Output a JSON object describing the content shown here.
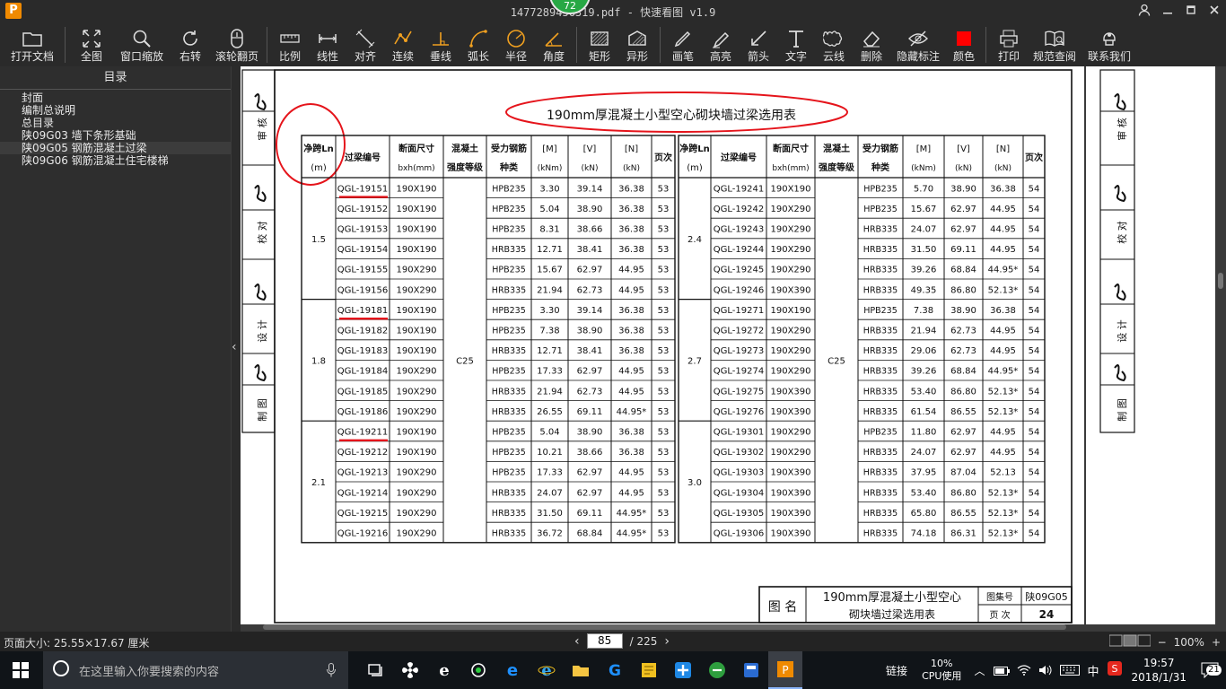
{
  "titlebar": {
    "title": "1477289456319.pdf - 快速看图 v1.9",
    "logo": "P",
    "badge": "72",
    "icons": [
      "user-icon",
      "minimize-icon",
      "maximize-icon",
      "close-icon"
    ]
  },
  "toolbar": {
    "items": [
      {
        "label": "打开文档",
        "icon": "folder-icon"
      },
      {
        "label": "全图",
        "icon": "fullview-icon"
      },
      {
        "label": "窗口缩放",
        "icon": "zoom-icon"
      },
      {
        "label": "右转",
        "icon": "rotate-icon"
      },
      {
        "label": "滚轮翻页",
        "icon": "mouse-icon"
      },
      {
        "label": "比例",
        "icon": "scale-icon"
      },
      {
        "label": "线性",
        "icon": "linear-icon"
      },
      {
        "label": "对齐",
        "icon": "align-icon"
      },
      {
        "label": "连续",
        "icon": "continuous-icon"
      },
      {
        "label": "垂线",
        "icon": "perpendicular-icon"
      },
      {
        "label": "弧长",
        "icon": "arc-icon"
      },
      {
        "label": "半径",
        "icon": "radius-icon"
      },
      {
        "label": "角度",
        "icon": "angle-icon"
      },
      {
        "label": "矩形",
        "icon": "rectangle-icon"
      },
      {
        "label": "异形",
        "icon": "shape-icon"
      },
      {
        "label": "画笔",
        "icon": "pen-icon"
      },
      {
        "label": "高亮",
        "icon": "highlight-icon"
      },
      {
        "label": "箭头",
        "icon": "arrow-icon"
      },
      {
        "label": "文字",
        "icon": "text-icon"
      },
      {
        "label": "云线",
        "icon": "cloud-icon"
      },
      {
        "label": "删除",
        "icon": "eraser-icon"
      },
      {
        "label": "隐藏标注",
        "icon": "eye-off-icon"
      },
      {
        "label": "颜色",
        "icon": "color-icon"
      },
      {
        "label": "打印",
        "icon": "printer-icon"
      },
      {
        "label": "规范查阅",
        "icon": "book-icon"
      },
      {
        "label": "联系我们",
        "icon": "support-icon"
      }
    ]
  },
  "sidebar": {
    "header": "目录",
    "items": [
      {
        "label": "封面",
        "selected": false
      },
      {
        "label": "编制总说明",
        "selected": false
      },
      {
        "label": "总目录",
        "selected": false
      },
      {
        "label": "陕09G03 墙下条形基础",
        "selected": false
      },
      {
        "label": "陕09G05 钢筋混凝土过梁",
        "selected": true
      },
      {
        "label": "陕09G06 钢筋混凝土住宅楼梯",
        "selected": false
      }
    ]
  },
  "sheet": {
    "title": "190mm厚混凝土小型空心砌块墙过梁选用表",
    "headers": {
      "span": "净跨Ln",
      "span_unit": "(m)",
      "code": "过梁编号",
      "section": "断面尺寸",
      "section_unit": "bxh(mm)",
      "concrete": "混凝土",
      "concrete2": "强度等级",
      "steel": "受力钢筋",
      "steel2": "种类",
      "m": "[M]",
      "m_unit": "(kNm)",
      "v": "[V]",
      "v_unit": "(kN)",
      "n": "[N]",
      "n_unit": "(kN)",
      "page": "页次"
    },
    "concrete_grade": "C25",
    "left_groups": [
      {
        "span": "1.5",
        "rows": [
          [
            "QGL-19151",
            "190X190",
            "HPB235",
            "3.30",
            "39.14",
            "36.38",
            "53"
          ],
          [
            "QGL-19152",
            "190X190",
            "HPB235",
            "5.04",
            "38.90",
            "36.38",
            "53"
          ],
          [
            "QGL-19153",
            "190X190",
            "HPB235",
            "8.31",
            "38.66",
            "36.38",
            "53"
          ],
          [
            "QGL-19154",
            "190X190",
            "HRB335",
            "12.71",
            "38.41",
            "36.38",
            "53"
          ],
          [
            "QGL-19155",
            "190X290",
            "HPB235",
            "15.67",
            "62.97",
            "44.95",
            "53"
          ],
          [
            "QGL-19156",
            "190X290",
            "HRB335",
            "21.94",
            "62.73",
            "44.95",
            "53"
          ]
        ]
      },
      {
        "span": "1.8",
        "rows": [
          [
            "QGL-19181",
            "190X190",
            "HPB235",
            "3.30",
            "39.14",
            "36.38",
            "53"
          ],
          [
            "QGL-19182",
            "190X190",
            "HPB235",
            "7.38",
            "38.90",
            "36.38",
            "53"
          ],
          [
            "QGL-19183",
            "190X190",
            "HRB335",
            "12.71",
            "38.41",
            "36.38",
            "53"
          ],
          [
            "QGL-19184",
            "190X290",
            "HPB235",
            "17.33",
            "62.97",
            "44.95",
            "53"
          ],
          [
            "QGL-19185",
            "190X290",
            "HRB335",
            "21.94",
            "62.73",
            "44.95",
            "53"
          ],
          [
            "QGL-19186",
            "190X290",
            "HRB335",
            "26.55",
            "69.11",
            "44.95*",
            "53"
          ]
        ]
      },
      {
        "span": "2.1",
        "rows": [
          [
            "QGL-19211",
            "190X190",
            "HPB235",
            "5.04",
            "38.90",
            "36.38",
            "53"
          ],
          [
            "QGL-19212",
            "190X190",
            "HPB235",
            "10.21",
            "38.66",
            "36.38",
            "53"
          ],
          [
            "QGL-19213",
            "190X290",
            "HPB235",
            "17.33",
            "62.97",
            "44.95",
            "53"
          ],
          [
            "QGL-19214",
            "190X290",
            "HRB335",
            "24.07",
            "62.97",
            "44.95",
            "53"
          ],
          [
            "QGL-19215",
            "190X290",
            "HRB335",
            "31.50",
            "69.11",
            "44.95*",
            "53"
          ],
          [
            "QGL-19216",
            "190X290",
            "HRB335",
            "36.72",
            "68.84",
            "44.95*",
            "53"
          ]
        ]
      }
    ],
    "right_groups": [
      {
        "span": "2.4",
        "rows": [
          [
            "QGL-19241",
            "190X190",
            "HPB235",
            "5.70",
            "38.90",
            "36.38",
            "54"
          ],
          [
            "QGL-19242",
            "190X290",
            "HPB235",
            "15.67",
            "62.97",
            "44.95",
            "54"
          ],
          [
            "QGL-19243",
            "190X290",
            "HRB335",
            "24.07",
            "62.97",
            "44.95",
            "54"
          ],
          [
            "QGL-19244",
            "190X290",
            "HRB335",
            "31.50",
            "69.11",
            "44.95",
            "54"
          ],
          [
            "QGL-19245",
            "190X290",
            "HRB335",
            "39.26",
            "68.84",
            "44.95*",
            "54"
          ],
          [
            "QGL-19246",
            "190X390",
            "HRB335",
            "49.35",
            "86.80",
            "52.13*",
            "54"
          ]
        ]
      },
      {
        "span": "2.7",
        "rows": [
          [
            "QGL-19271",
            "190X190",
            "HPB235",
            "7.38",
            "38.90",
            "36.38",
            "54"
          ],
          [
            "QGL-19272",
            "190X290",
            "HRB335",
            "21.94",
            "62.73",
            "44.95",
            "54"
          ],
          [
            "QGL-19273",
            "190X290",
            "HRB335",
            "29.06",
            "62.73",
            "44.95",
            "54"
          ],
          [
            "QGL-19274",
            "190X290",
            "HRB335",
            "39.26",
            "68.84",
            "44.95*",
            "54"
          ],
          [
            "QGL-19275",
            "190X390",
            "HRB335",
            "53.40",
            "86.80",
            "52.13*",
            "54"
          ],
          [
            "QGL-19276",
            "190X390",
            "HRB335",
            "61.54",
            "86.55",
            "52.13*",
            "54"
          ]
        ]
      },
      {
        "span": "3.0",
        "rows": [
          [
            "QGL-19301",
            "190X290",
            "HPB235",
            "11.80",
            "62.97",
            "44.95",
            "54"
          ],
          [
            "QGL-19302",
            "190X290",
            "HRB335",
            "24.07",
            "62.97",
            "44.95",
            "54"
          ],
          [
            "QGL-19303",
            "190X390",
            "HRB335",
            "37.95",
            "87.04",
            "52.13",
            "54"
          ],
          [
            "QGL-19304",
            "190X390",
            "HRB335",
            "53.40",
            "86.80",
            "52.13*",
            "54"
          ],
          [
            "QGL-19305",
            "190X390",
            "HRB335",
            "65.80",
            "86.55",
            "52.13*",
            "54"
          ],
          [
            "QGL-19306",
            "190X390",
            "HRB335",
            "74.18",
            "86.31",
            "52.13*",
            "54"
          ]
        ]
      }
    ],
    "stamp_labels": [
      "审 核",
      "校 对",
      "设 计",
      "制 图"
    ],
    "title_block": {
      "name_label": "图 名",
      "name_line1": "190mm厚混凝土小型空心",
      "name_line2": "砌块墙过梁选用表",
      "atlas_label": "图集号",
      "atlas_value": "陕09G05",
      "page_label": "页 次",
      "page_value": "24"
    }
  },
  "statusbar": {
    "page_size": "页面大小: 25.55×17.67 厘米",
    "current_page": "85",
    "total_pages": "/ 225",
    "zoom": "100%",
    "zoom_minus": "−",
    "zoom_plus": "+"
  },
  "taskbar": {
    "search_placeholder": "在这里输入你要搜索的内容",
    "link_label": "链接",
    "cpu_percent": "10%",
    "cpu_label": "CPU使用",
    "ime": "中",
    "time": "19:57",
    "date": "2018/1/31",
    "notifications": "21"
  },
  "colors": {
    "annotation_red": "#e5141b",
    "accent_green": "#27a844",
    "logo_orange": "#f08a00"
  }
}
